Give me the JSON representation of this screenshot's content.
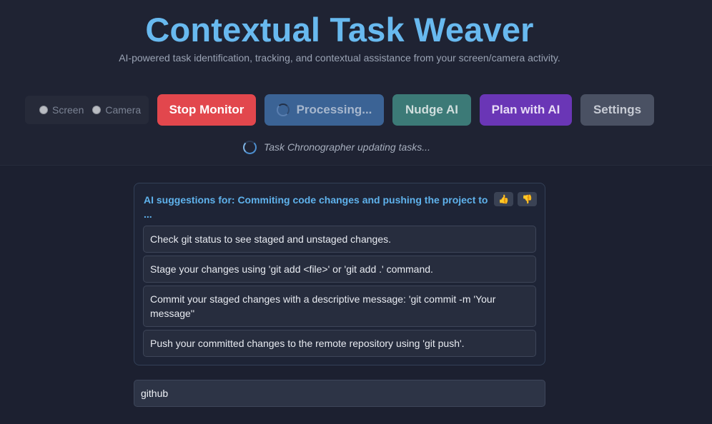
{
  "header": {
    "title": "Contextual Task Weaver",
    "subtitle": "AI-powered task identification, tracking, and contextual assistance from your screen/camera activity."
  },
  "source": {
    "options": [
      {
        "label": "Screen",
        "selected": false
      },
      {
        "label": "Camera",
        "selected": false
      }
    ]
  },
  "toolbar": {
    "stop_label": "Stop Monitor",
    "processing_label": "Processing...",
    "nudge_label": "Nudge AI",
    "plan_label": "Plan with AI",
    "settings_label": "Settings"
  },
  "status": {
    "text": "Task Chronographer updating tasks..."
  },
  "suggestions": {
    "heading": "AI suggestions for: Commiting code changes and pushing the project to ...",
    "thumbs_up_icon": "👍",
    "thumbs_down_icon": "👎",
    "items": [
      "Check git status to see staged and unstaged changes.",
      "Stage your changes using 'git add <file>' or 'git add .' command.",
      "Commit your staged changes with a descriptive message: 'git commit -m 'Your message''",
      "Push your committed changes to the remote repository using 'git push'."
    ]
  },
  "input": {
    "value": "github"
  },
  "colors": {
    "title": "#68b9ef",
    "stop": "#e2474d",
    "processing": "#3b6395",
    "nudge": "#3c7a77",
    "plan": "#6a36b6",
    "settings": "#4a5163"
  }
}
